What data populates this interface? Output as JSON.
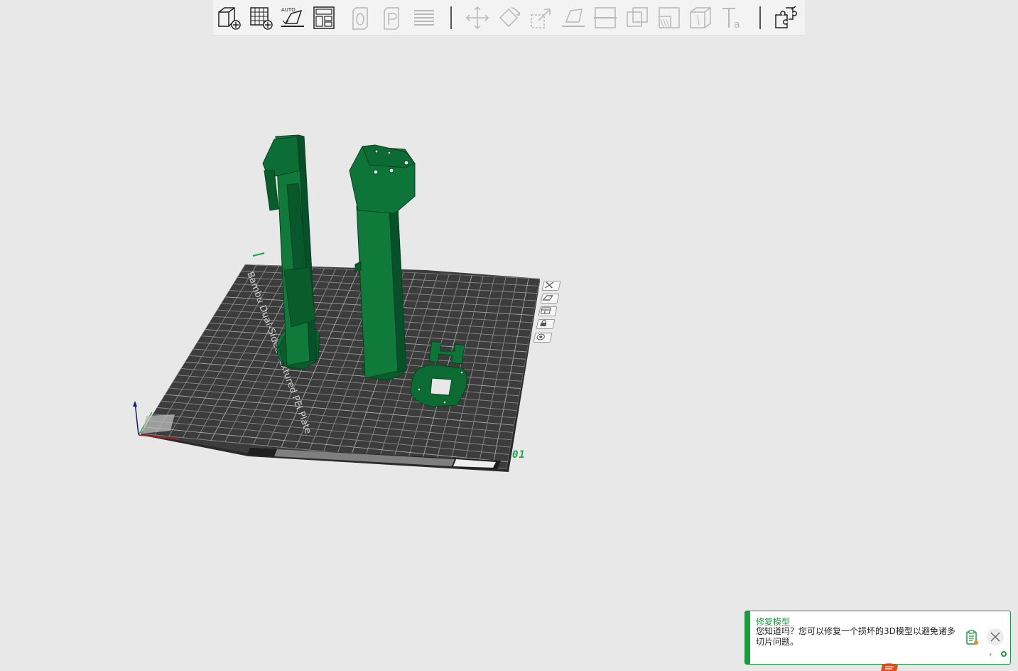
{
  "toolbar": {
    "buttons": [
      {
        "name": "add-object-button",
        "icon": "cube-add-icon",
        "enabled": true
      },
      {
        "name": "add-plate-button",
        "icon": "grid-add-icon",
        "enabled": true
      },
      {
        "name": "auto-orient-button",
        "icon": "auto-orient-icon",
        "label": "AUTO",
        "enabled": true
      },
      {
        "name": "arrange-button",
        "icon": "arrange-icon",
        "enabled": true
      },
      {
        "name": "split-objects-button",
        "icon": "split-objects-icon",
        "enabled": false
      },
      {
        "name": "split-parts-button",
        "icon": "split-parts-icon",
        "enabled": false
      },
      {
        "name": "layers-button",
        "icon": "layers-icon",
        "enabled": false
      },
      {
        "name": "move-button",
        "icon": "move-icon",
        "enabled": false
      },
      {
        "name": "rotate-button",
        "icon": "rotate-icon",
        "enabled": false
      },
      {
        "name": "scale-button",
        "icon": "scale-icon",
        "enabled": false
      },
      {
        "name": "lay-on-face-button",
        "icon": "lay-on-face-icon",
        "enabled": false
      },
      {
        "name": "cut-button",
        "icon": "cut-icon",
        "enabled": false
      },
      {
        "name": "boolean-button",
        "icon": "boolean-icon",
        "enabled": false
      },
      {
        "name": "support-paint-button",
        "icon": "support-paint-icon",
        "enabled": false
      },
      {
        "name": "seam-paint-button",
        "icon": "seam-paint-icon",
        "enabled": false
      },
      {
        "name": "text-button",
        "icon": "text-icon",
        "enabled": false
      },
      {
        "name": "assembly-button",
        "icon": "assembly-icon",
        "enabled": true
      }
    ]
  },
  "viewport": {
    "plate_label": "Bambu Dual-Sided Textured PEI Plate",
    "plate_number": "01",
    "model_color": "#0c6b32",
    "plate_color": "#3c3c3c",
    "plate_buttons": [
      {
        "name": "plate-delete-button",
        "icon": "close-icon"
      },
      {
        "name": "plate-orient-button",
        "icon": "orient-icon"
      },
      {
        "name": "plate-arrange-button",
        "icon": "arrange-icon"
      },
      {
        "name": "plate-lock-button",
        "icon": "lock-icon"
      },
      {
        "name": "plate-settings-button",
        "icon": "settings-icon"
      }
    ]
  },
  "notification": {
    "title": "修复模型",
    "body": "您知道吗？您可以修复一个损坏的3D模型以避免诸多切片问题。",
    "more": "›",
    "accent": "#1a9b3f"
  }
}
